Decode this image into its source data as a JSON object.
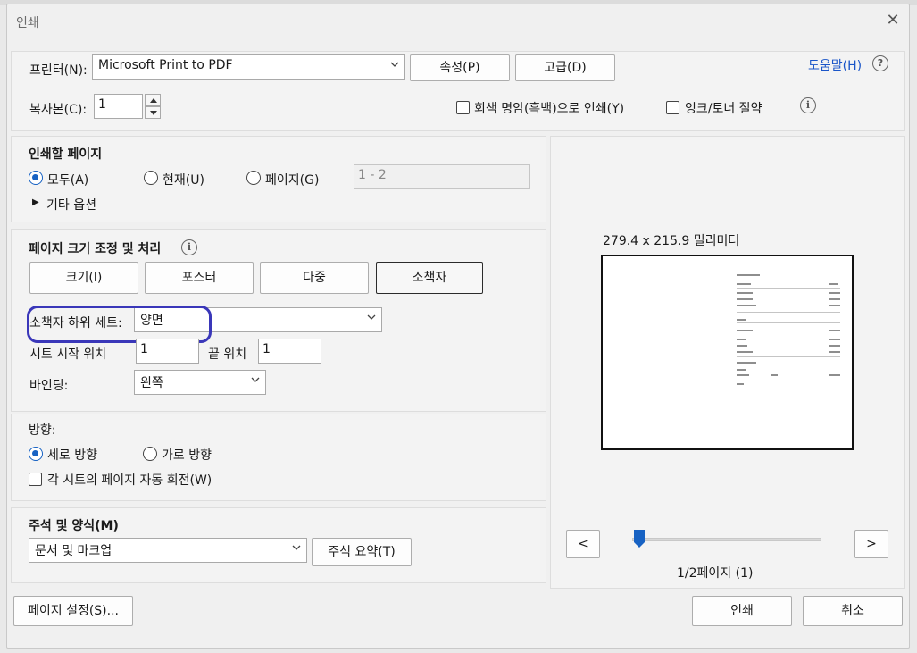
{
  "window": {
    "title": "인쇄",
    "close_glyph": "✕"
  },
  "printer": {
    "label": "프린터(N):",
    "selected": "Microsoft Print to PDF",
    "properties_button": "속성(P)",
    "advanced_button": "고급(D)"
  },
  "help": {
    "link": "도움말(H)",
    "icon_glyph": "?"
  },
  "copies": {
    "label": "복사본(C):",
    "value": "1"
  },
  "options": {
    "grayscale": "회색 명암(흑백)으로 인쇄(Y)",
    "save_ink": "잉크/토너 절약",
    "info_glyph": "i"
  },
  "pages_to_print": {
    "title": "인쇄할 페이지",
    "all": "모두(A)",
    "current": "현재(U)",
    "pages": "페이지(G)",
    "pages_range_placeholder": "1 - 2",
    "more_options": "기타 옵션",
    "more_options_glyph": "▶"
  },
  "sizing": {
    "title": "페이지 크기 조정 및 처리",
    "info_glyph": "i",
    "tabs": [
      "크기(I)",
      "포스터",
      "다중",
      "소책자"
    ],
    "booklet_subset_label": "소책자 하위 세트:",
    "booklet_subset_value": "양면",
    "sheet_from_label": "시트 시작 위치",
    "sheet_from_value": "1",
    "sheet_to_label": "끝 위치",
    "sheet_to_value": "1",
    "binding_label": "바인딩:",
    "binding_value": "왼쪽"
  },
  "orientation": {
    "title": "방향:",
    "portrait": "세로 방향",
    "landscape": "가로 방향",
    "auto_rotate": "각 시트의 페이지 자동 회전(W)"
  },
  "comments": {
    "title": "주석 및 양식(M)",
    "selected": "문서 및 마크업",
    "summarize_button": "주석 요약(T)"
  },
  "preview": {
    "size_text": "279.4 x 215.9 밀리미터",
    "prev_button": "<",
    "next_button": ">",
    "page_indicator": "1/2페이지 (1)",
    "slider_position": 0
  },
  "footer": {
    "page_setup_button": "페이지 설정(S)...",
    "print_button": "인쇄",
    "cancel_button": "취소"
  },
  "colors": {
    "accent": "#1762c3",
    "highlight_annotation": "#3a37b9",
    "link": "#1a55c8"
  }
}
